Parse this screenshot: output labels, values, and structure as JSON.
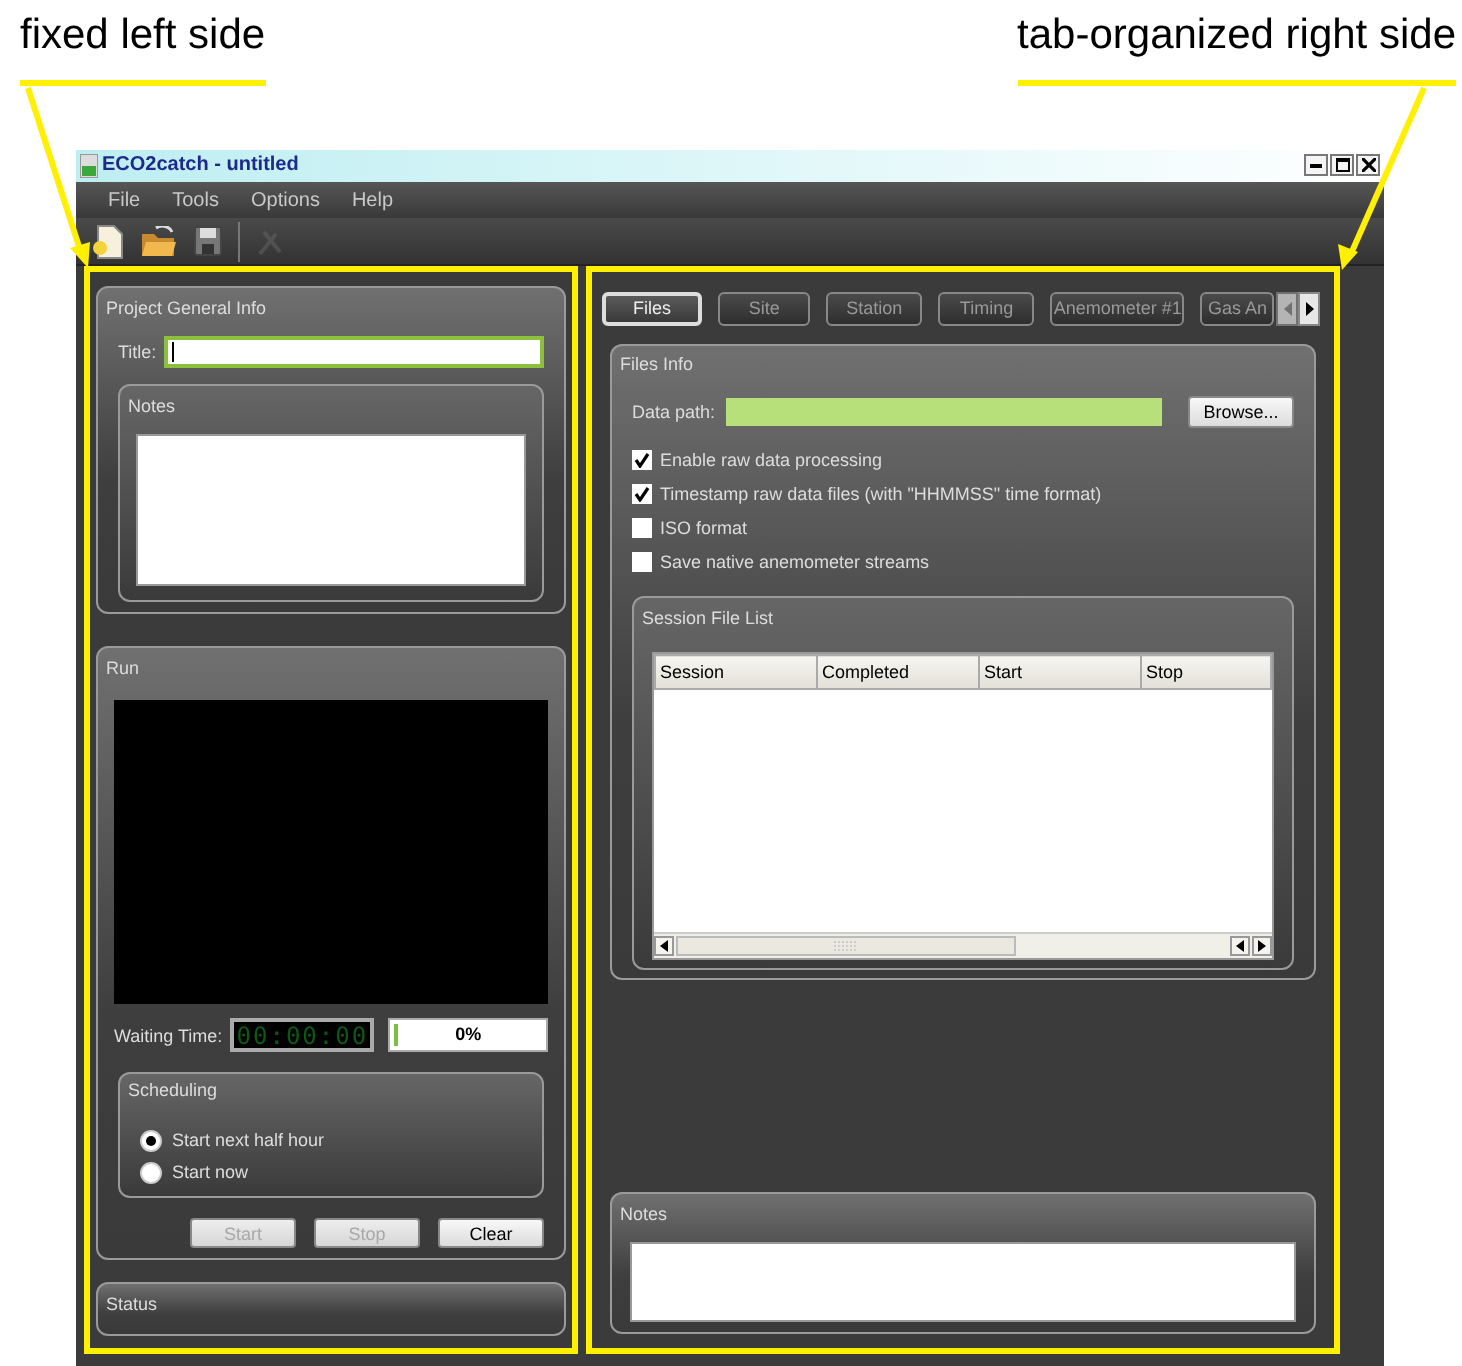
{
  "annotations": [
    {
      "text": "fixed left side"
    },
    {
      "text": "tab-organized right side"
    }
  ],
  "window": {
    "title": "ECO2catch - untitled"
  },
  "menu": [
    "File",
    "Tools",
    "Options",
    "Help"
  ],
  "toolbar": [
    {
      "kind": "new",
      "disabled": false
    },
    {
      "kind": "open",
      "disabled": false
    },
    {
      "kind": "save",
      "disabled": false
    },
    {
      "kind": "tool",
      "disabled": true
    }
  ],
  "project_info": {
    "title": "Project General Info",
    "title_label": "Title:",
    "notes_title": "Notes"
  },
  "run": {
    "title": "Run",
    "waiting_label": "Waiting Time:",
    "timer": "00:00:00",
    "progress": {
      "level": 0.02,
      "reading": "0%"
    },
    "scheduling": {
      "title": "Scheduling",
      "options": [
        {
          "label": "Start next half hour",
          "selected": true
        },
        {
          "label": "Start now",
          "selected": false
        }
      ]
    },
    "buttons": [
      {
        "label": "Start",
        "disabled": true
      },
      {
        "label": "Stop",
        "disabled": true
      },
      {
        "label": "Clear",
        "disabled": false
      }
    ]
  },
  "status": {
    "title": "Status"
  },
  "tabs": [
    {
      "label": "Files",
      "selected": true
    },
    {
      "label": "Site",
      "selected": false
    },
    {
      "label": "Station",
      "selected": false
    },
    {
      "label": "Timing",
      "selected": false
    },
    {
      "label": "Anemometer #1",
      "selected": false
    },
    {
      "label": "Gas An",
      "selected": false
    }
  ],
  "files_info": {
    "title": "Files Info",
    "data_path_label": "Data path:",
    "browse": "Browse...",
    "options": [
      {
        "label": "Enable raw data processing",
        "checked": true
      },
      {
        "label": "Timestamp raw data files (with \"HHMMSS\" time format)",
        "checked": true
      },
      {
        "label": "ISO format",
        "checked": false
      },
      {
        "label": "Save native anemometer streams",
        "checked": false
      }
    ]
  },
  "session_list": {
    "title": "Session File List",
    "columns": [
      "Session",
      "Completed",
      "Start",
      "Stop"
    ]
  },
  "notes": {
    "title": "Notes"
  }
}
